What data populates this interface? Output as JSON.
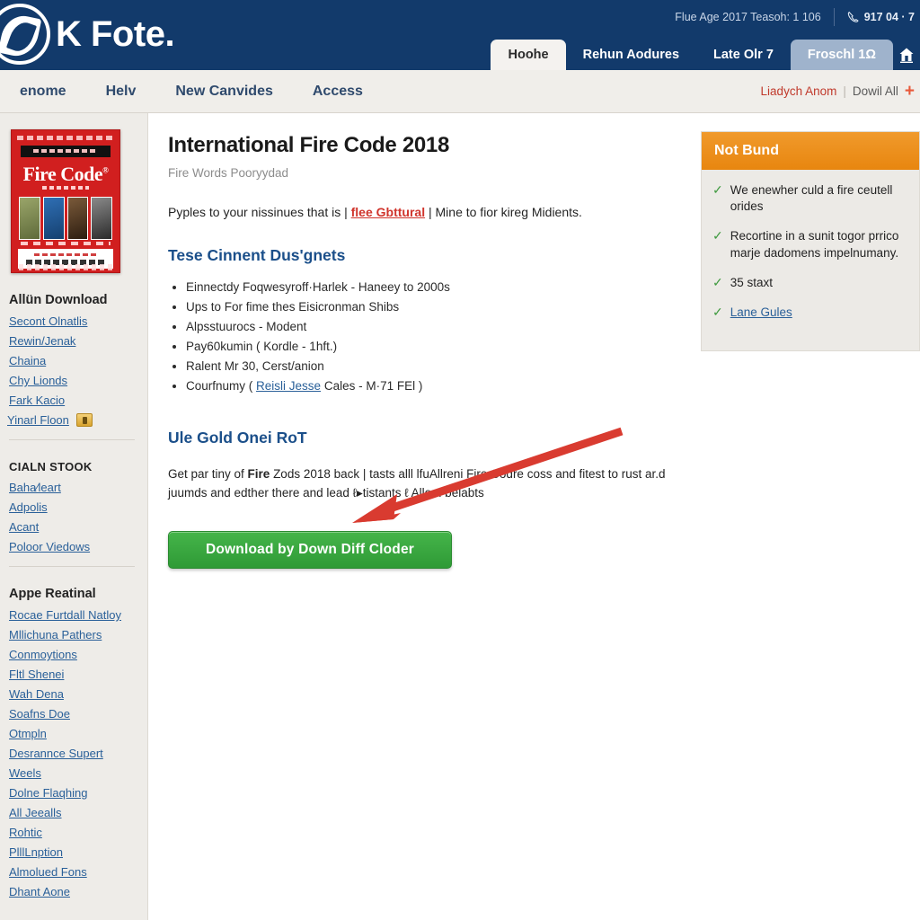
{
  "brand": {
    "name": "K Fote",
    "dot": ".",
    "logo_icon": "circle-swoosh-logo-icon"
  },
  "header": {
    "utility_text": "Flue Age 2017 Teasoh: 1 106",
    "phone": "917 04 · 7",
    "phone_icon": "phone-icon",
    "tabs": [
      {
        "label": "Hoohe",
        "state": "active"
      },
      {
        "label": "Rehun Aodures",
        "state": "normal"
      },
      {
        "label": "Late Olr 7",
        "state": "normal"
      },
      {
        "label": "Froschl 1Ω",
        "state": "alt"
      }
    ],
    "home_icon": "home-icon"
  },
  "subnav": {
    "items": [
      {
        "label": "enome"
      },
      {
        "label": "Helv"
      },
      {
        "label": "New Canvides"
      },
      {
        "label": "Access"
      }
    ],
    "right": {
      "red_link": "Liadych Anom",
      "divider": "|",
      "grey_link": "Dowil All",
      "plus": "+"
    }
  },
  "sidebar": {
    "book_cover": {
      "title": "Fire Code",
      "superscript": "®",
      "icon": "book-cover-image"
    },
    "groups": [
      {
        "heading": "Allün Download",
        "links": [
          {
            "label": "Secont Olnatlis"
          },
          {
            "label": "Rewin/Jenak"
          },
          {
            "label": "Chaina"
          },
          {
            "label": "Chy Lionds"
          },
          {
            "label": "Fark Kacio"
          },
          {
            "label": "Yinarl Floon",
            "badge": "lock-badge-icon"
          }
        ]
      },
      {
        "heading": "CIALN STOOK",
        "links": [
          {
            "label": "Baha∕leart"
          },
          {
            "label": "Adpolis"
          },
          {
            "label": "Acant"
          },
          {
            "label": "Poloor Viedows"
          }
        ]
      },
      {
        "heading": "Appe Reatinal",
        "links": [
          {
            "label": "Rocae Furtdall Natloy"
          },
          {
            "label": "Mllichuna Pathers"
          },
          {
            "label": "Conmoytions"
          },
          {
            "label": "Fltl Shenei"
          },
          {
            "label": "Wah Dena"
          },
          {
            "label": "Soafns Doe"
          },
          {
            "label": "Otmpln"
          },
          {
            "label": "Desrannce Supert"
          },
          {
            "label": "Weels"
          },
          {
            "label": "Dolne Flaqhing"
          },
          {
            "label": "All Jeealls"
          },
          {
            "label": "Rohtic"
          },
          {
            "label": "PlllLnption"
          },
          {
            "label": "Almolued Fons"
          },
          {
            "label": "Dhant Aone"
          }
        ]
      }
    ]
  },
  "main": {
    "title": "International Fire Code 2018",
    "subtitle": "Fire Words Pooryydad",
    "lead_before": "Pyples to your nissinues that is | ",
    "lead_link": "flee Gbttural",
    "lead_after": " | Mine to fior kireg Midients.",
    "section1_heading": "Tese Cinnent Dus'gnets",
    "bullets": [
      {
        "text": "Einnectdy Foqwesyroff·Harlek - Haneey to 2000s"
      },
      {
        "text": "Ups to For fime thes Eisicronman Shibs"
      },
      {
        "text": "Alpsstuurocs - Modent"
      },
      {
        "text": "Pay60kumin ( Kordle - 1hft.)"
      },
      {
        "text": "Ralent Mr 30, Cerst/anion"
      },
      {
        "text_before": "Courfnumy ( ",
        "link": "Reisli Jesse",
        "text_after": " Cales - M·71 FEl )"
      }
    ],
    "section2_heading": "Ule Gold Onei RoT",
    "body_before": "Get par tiny of ",
    "body_bold": "Fire",
    "body_after": " Zods 2018 back | tasts alll lfuAllreni Fire Codre coss and fitest to rust ar.d juumds and edther there and lead ℓ▸tistants ℓ Allom belabts",
    "download_button": "Download by Down Diff Cloder"
  },
  "right_panel": {
    "heading": "Not Bund",
    "items": [
      {
        "check": "check-icon",
        "text": "We enewher culd a fire ceutell orides"
      },
      {
        "check": "check-icon",
        "text": "Recortine in a sunit togor prrico marje dadomens impelnumany."
      },
      {
        "check": "check-icon",
        "text": "35 staxt"
      },
      {
        "check": "check-icon",
        "link": "Lane Gules"
      }
    ]
  },
  "annotation": {
    "arrow": "red-arrow-annotation",
    "color": "#d93b30"
  },
  "colors": {
    "header_blue": "#123a6b",
    "accent_orange": "#e8860f",
    "button_green": "#2f9a36",
    "link_blue": "#2a6099",
    "red": "#c0392b"
  }
}
